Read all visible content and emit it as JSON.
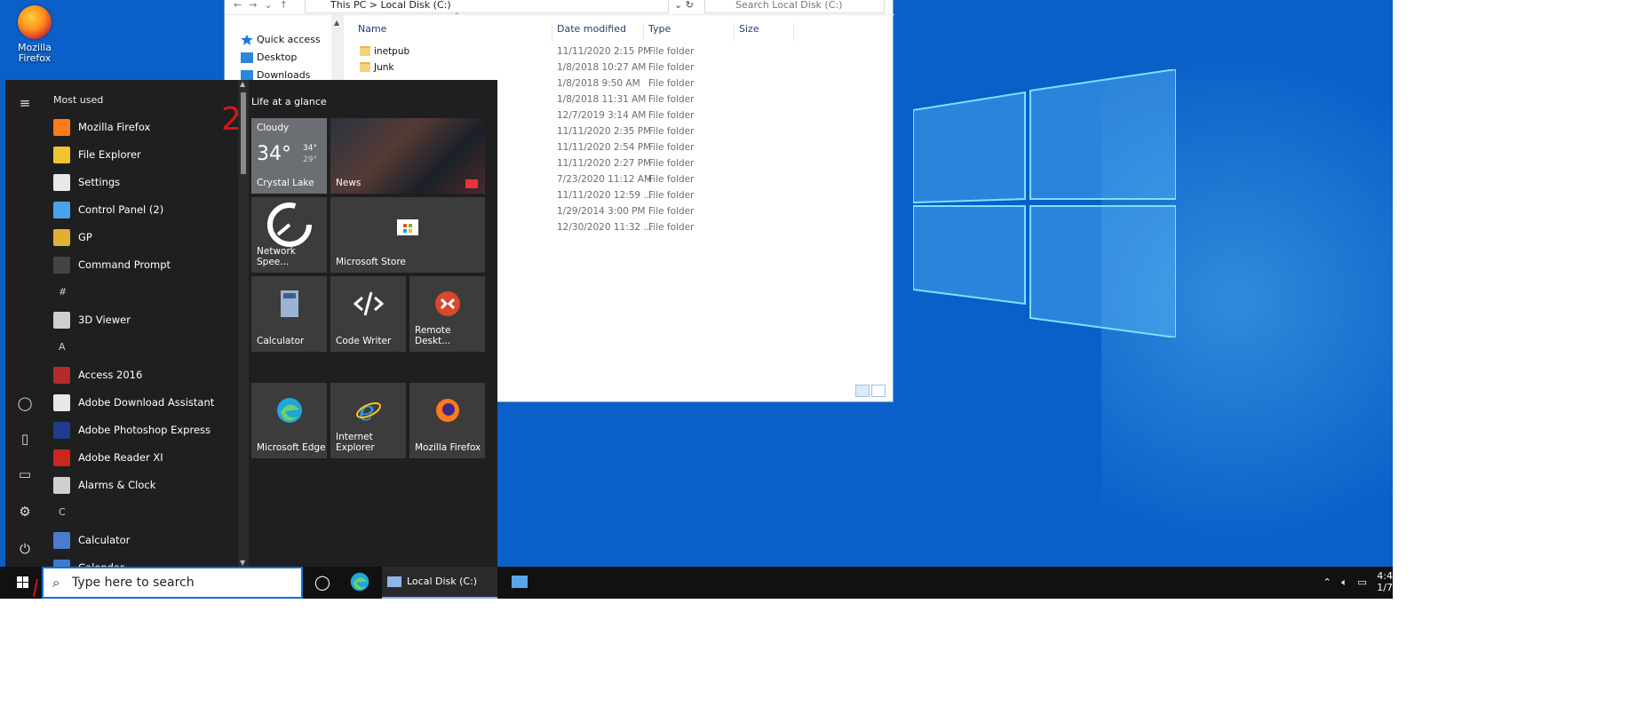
{
  "desktop": {
    "icon_label": "Mozilla Firefox",
    "icon": "firefox-icon"
  },
  "explorer": {
    "breadcrumb": [
      "This PC",
      "Local Disk (C:)"
    ],
    "search_placeholder": "Search Local Disk (C:)",
    "nav": [
      {
        "label": "Quick access",
        "icon": "star-icon"
      },
      {
        "label": "Desktop",
        "icon": "desktop-folder-icon"
      },
      {
        "label": "Downloads",
        "icon": "download-icon"
      }
    ],
    "columns": [
      "Name",
      "Date modified",
      "Type",
      "Size"
    ],
    "rows": [
      {
        "name": "inetpub",
        "date": "11/11/2020 2:15 PM",
        "type": "File folder"
      },
      {
        "name": "Junk",
        "date": "1/8/2018 10:27 AM",
        "type": "File folder"
      },
      {
        "name": "",
        "date": "1/8/2018 9:50 AM",
        "type": "File folder"
      },
      {
        "name": "",
        "date": "1/8/2018 11:31 AM",
        "type": "File folder"
      },
      {
        "name": "",
        "date": "12/7/2019 3:14 AM",
        "type": "File folder"
      },
      {
        "name": "",
        "date": "11/11/2020 2:35 PM",
        "type": "File folder"
      },
      {
        "name": "",
        "date": "11/11/2020 2:54 PM",
        "type": "File folder"
      },
      {
        "name": "",
        "date": "11/11/2020 2:27 PM",
        "type": "File folder"
      },
      {
        "name": "",
        "date": "7/23/2020 11:12 AM",
        "type": "File folder"
      },
      {
        "name": "",
        "date": "11/11/2020 12:59 ...",
        "type": "File folder"
      },
      {
        "name": "",
        "date": "1/29/2014 3:00 PM",
        "type": "File folder"
      },
      {
        "name": "",
        "date": "12/30/2020 11:32 ...",
        "type": "File folder"
      }
    ]
  },
  "start_menu": {
    "most_used_header": "Most used",
    "annotation_mark": "2",
    "apps": [
      {
        "label": "Mozilla Firefox",
        "icon": "firefox-icon",
        "color": "#ff7a1a"
      },
      {
        "label": "File Explorer",
        "icon": "folder-icon",
        "color": "#f3c230"
      },
      {
        "label": "Settings",
        "icon": "gear-icon",
        "color": "#e8e8e8"
      },
      {
        "label": "Control Panel (2)",
        "icon": "control-panel-icon",
        "color": "#4aa3e8"
      },
      {
        "label": "GP",
        "icon": "gp-icon",
        "color": "#e0b030"
      },
      {
        "label": "Command Prompt",
        "icon": "terminal-icon",
        "color": "#444444"
      }
    ],
    "groups": [
      {
        "letter": "#",
        "apps": [
          {
            "label": "3D Viewer",
            "icon": "cube-icon",
            "color": "#cfcfcf"
          }
        ]
      },
      {
        "letter": "A",
        "apps": [
          {
            "label": "Access 2016",
            "icon": "access-icon",
            "color": "#b52a2a"
          },
          {
            "label": "Adobe Download Assistant",
            "icon": "adobe-icon",
            "color": "#e8e8e8"
          },
          {
            "label": "Adobe Photoshop Express",
            "icon": "photoshop-icon",
            "color": "#1d3e8a"
          },
          {
            "label": "Adobe Reader XI",
            "icon": "pdf-icon",
            "color": "#c8281e"
          },
          {
            "label": "Alarms & Clock",
            "icon": "clock-icon",
            "color": "#cfcfcf"
          }
        ]
      },
      {
        "letter": "C",
        "apps": [
          {
            "label": "Calculator",
            "icon": "calculator-icon",
            "color": "#4a7bd0"
          },
          {
            "label": "Calendar",
            "icon": "calendar-icon",
            "color": "#3a7bd0"
          }
        ]
      }
    ],
    "tiles_header": "Life at a glance",
    "weather": {
      "condition": "Cloudy",
      "temp": "34°",
      "high": "34°",
      "low": "29°",
      "city": "Crystal Lake"
    },
    "tiles": [
      {
        "label": "News",
        "icon": "news-icon"
      },
      {
        "label": "Network Spee...",
        "icon": "speed-gauge-icon"
      },
      {
        "label": "Microsoft Store",
        "icon": "store-icon"
      },
      {
        "label": "Calculator",
        "icon": "calculator-icon"
      },
      {
        "label": "Code Writer",
        "icon": "code-writer-icon"
      },
      {
        "label": "Remote Deskt...",
        "icon": "remote-desktop-icon"
      },
      {
        "label": "Microsoft Edge",
        "icon": "edge-icon"
      },
      {
        "label": "Internet Explorer",
        "icon": "ie-icon"
      },
      {
        "label": "Mozilla Firefox",
        "icon": "firefox-icon"
      }
    ]
  },
  "taskbar": {
    "search_placeholder": "Type here to search",
    "active_window": "Local Disk (C:)",
    "clock_partial": "4:4",
    "date_partial": "1/7"
  }
}
